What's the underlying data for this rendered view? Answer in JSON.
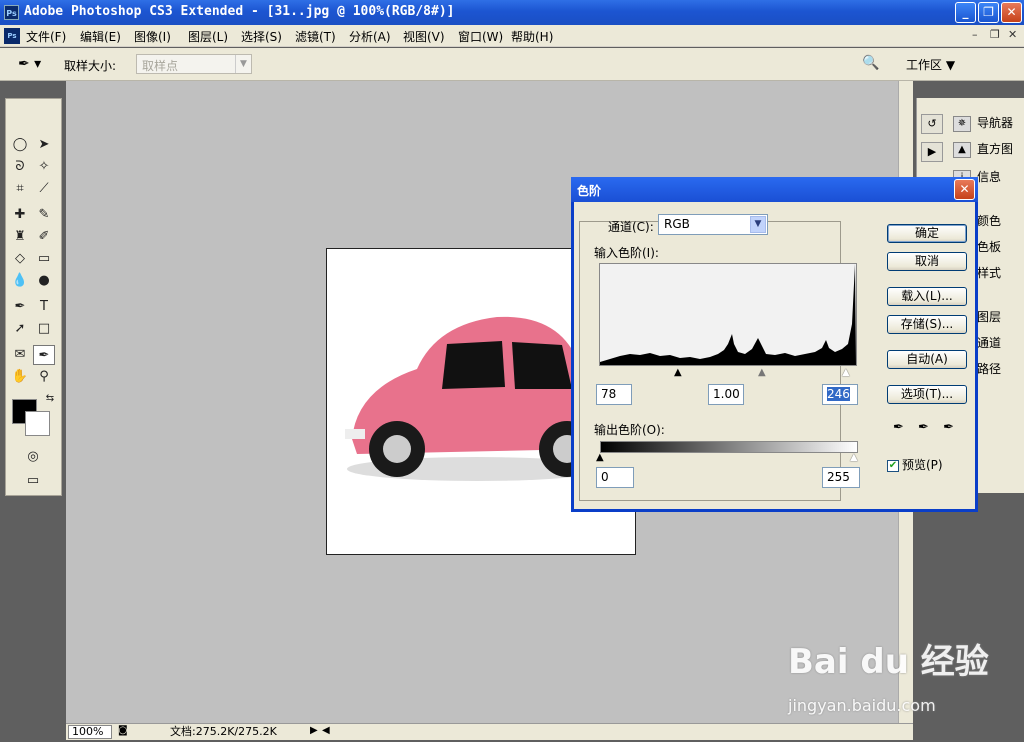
{
  "window": {
    "title": "Adobe Photoshop CS3 Extended - [31..jpg @ 100%(RGB/8#)]",
    "app_icon": "Ps"
  },
  "menu": [
    "文件(F)",
    "编辑(E)",
    "图像(I)",
    "图层(L)",
    "选择(S)",
    "滤镜(T)",
    "分析(A)",
    "视图(V)",
    "窗口(W)",
    "帮助(H)"
  ],
  "options": {
    "sample_size_label": "取样大小:",
    "sample_size_value": "取样点",
    "workspace": "工作区 ▼"
  },
  "status": {
    "zoom": "100%",
    "doc": "文档:275.2K/275.2K"
  },
  "dock": {
    "items": [
      {
        "label": "导航器",
        "icon": "navigator-icon"
      },
      {
        "label": "直方图",
        "icon": "histogram-icon"
      },
      {
        "label": "信息",
        "icon": "info-icon"
      },
      {
        "label": "颜色",
        "icon": "color-icon"
      },
      {
        "label": "色板",
        "icon": "swatches-icon"
      },
      {
        "label": "样式",
        "icon": "styles-icon"
      },
      {
        "label": "图层",
        "icon": "layers-icon"
      },
      {
        "label": "通道",
        "icon": "channels-icon"
      },
      {
        "label": "路径",
        "icon": "paths-icon"
      }
    ]
  },
  "dialog": {
    "title": "色阶",
    "channel_label": "通道(C):",
    "channel_value": "RGB",
    "input_label": "输入色阶(I):",
    "input_black": "78",
    "input_gamma": "1.00",
    "input_white": "246",
    "output_label": "输出色阶(O):",
    "output_black": "0",
    "output_white": "255",
    "buttons": {
      "ok": "确定",
      "cancel": "取消",
      "load": "载入(L)...",
      "save": "存储(S)...",
      "auto": "自动(A)",
      "options": "选项(T)..."
    },
    "preview_label": "预览(P)",
    "preview_checked": true
  },
  "watermark": {
    "brand": "Bai du 经验",
    "url": "jingyan.baidu.com"
  }
}
